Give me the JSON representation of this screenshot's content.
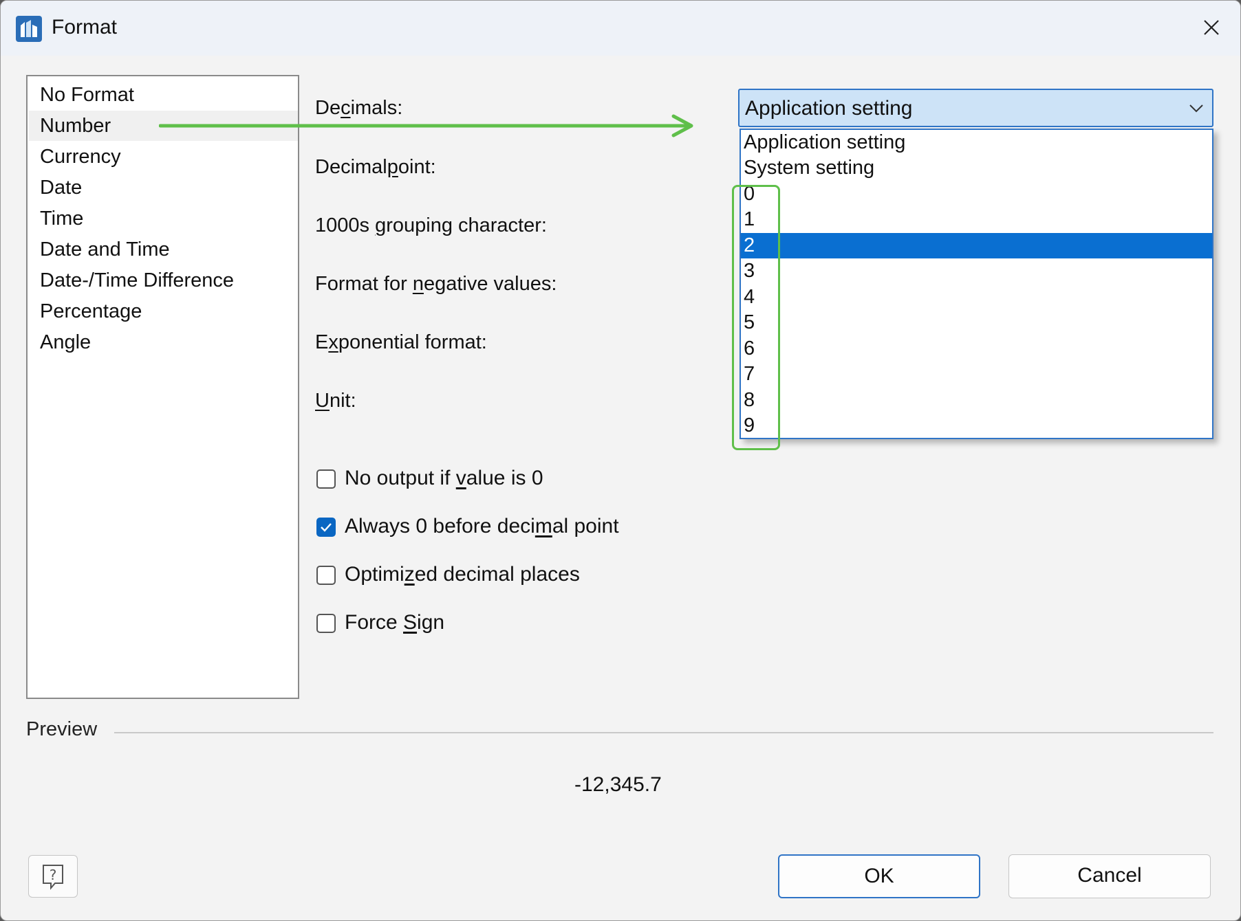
{
  "window": {
    "title": "Format"
  },
  "categories": [
    {
      "label": "No Format"
    },
    {
      "label": "Number",
      "selected": true
    },
    {
      "label": "Currency"
    },
    {
      "label": "Date"
    },
    {
      "label": "Time"
    },
    {
      "label": "Date and Time"
    },
    {
      "label": "Date-/Time Difference"
    },
    {
      "label": "Percentage"
    },
    {
      "label": "Angle"
    }
  ],
  "fields": {
    "decimals": {
      "pre": "De",
      "u": "c",
      "post": "imals:"
    },
    "decimalpoint": {
      "pre": "Decimal",
      "u": "p",
      "post": "oint:"
    },
    "grouping": {
      "pre": "1000s ",
      "u": "g",
      "post": "rouping character:"
    },
    "negative": {
      "pre": "Format for ",
      "u": "n",
      "post": "egative values:"
    },
    "exponential": {
      "pre": "E",
      "u": "x",
      "post": "ponential format:"
    },
    "unit": {
      "pre": "",
      "u": "U",
      "post": "nit:"
    }
  },
  "decimals_select": {
    "value": "Application setting",
    "options": [
      "Application setting",
      "System setting",
      "0",
      "1",
      "2",
      "3",
      "4",
      "5",
      "6",
      "7",
      "8",
      "9"
    ],
    "highlighted": "2"
  },
  "options": {
    "no_output": {
      "pre": "No output if ",
      "u": "v",
      "post": "alue is 0",
      "checked": false
    },
    "always_zero": {
      "pre": "Always 0 before deci",
      "u": "m",
      "post": "al point",
      "checked": true
    },
    "optimized": {
      "pre": "Optimi",
      "u": "z",
      "post": "ed decimal places",
      "checked": false
    },
    "force_sign": {
      "pre": "Force ",
      "u": "S",
      "post": "ign",
      "checked": false
    }
  },
  "preview": {
    "label": "Preview",
    "value": "-12,345.7"
  },
  "buttons": {
    "ok": "OK",
    "cancel": "Cancel"
  },
  "colors": {
    "accent": "#0a6fd1",
    "annotation": "#5fbf4a"
  }
}
